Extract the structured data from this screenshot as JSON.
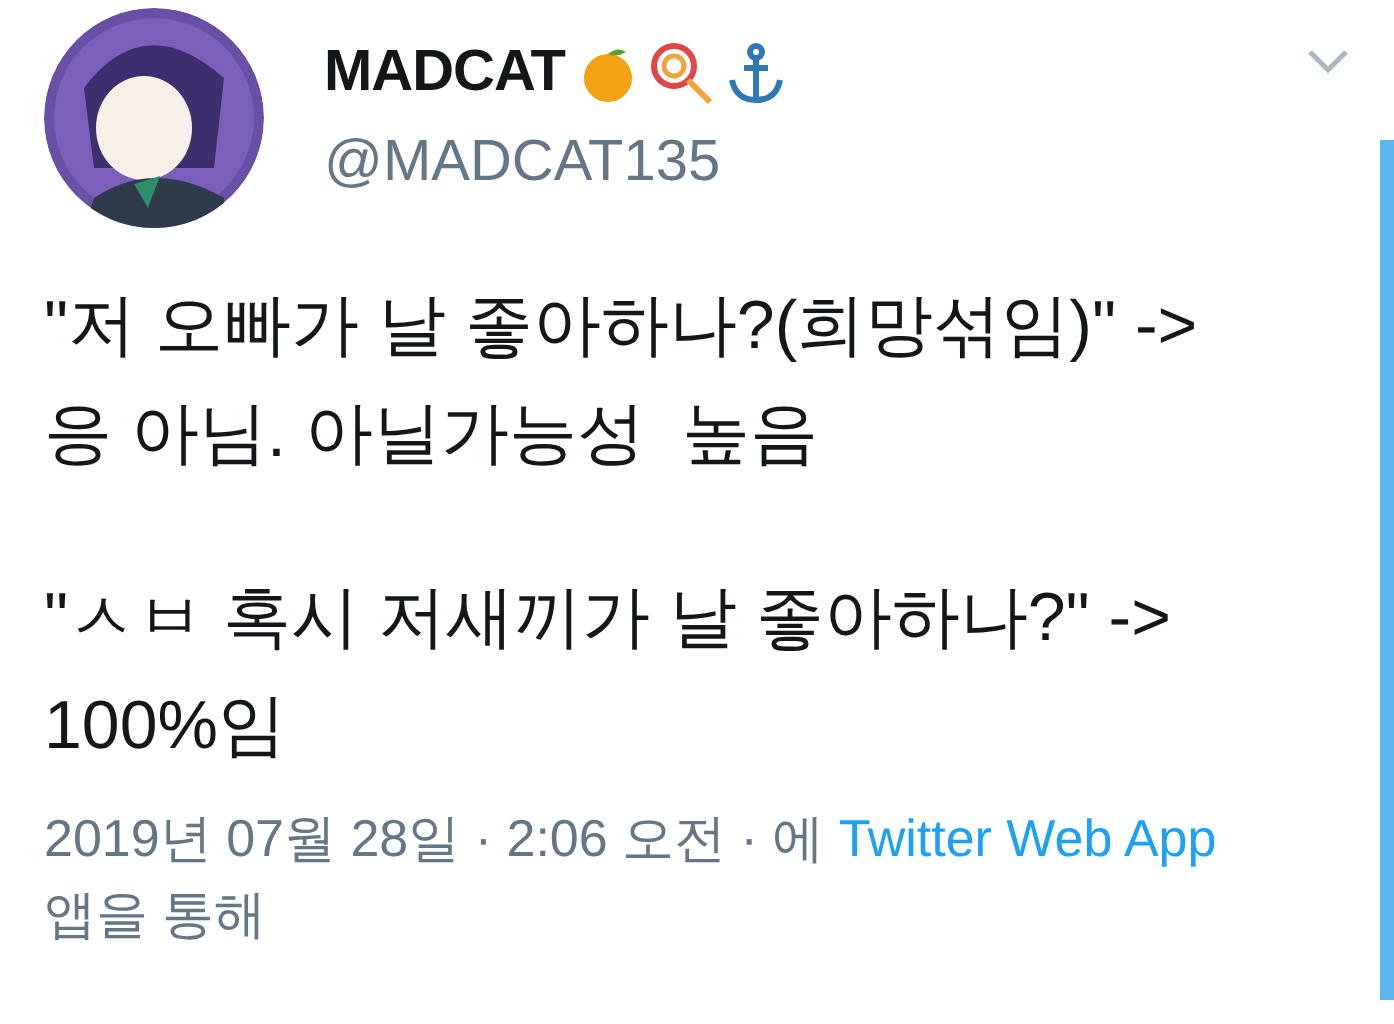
{
  "author": {
    "name": "MADCAT",
    "handle": "@MADCAT135"
  },
  "paragraphs": [
    "\"저 오빠가 날 좋아하나?(희망섞임)\" -> 응 아님. 아닐가능성  높음",
    "\"ㅅㅂ 혹시 저새끼가 날 좋아하나?\" -> 100%임"
  ],
  "meta": {
    "prefix": "2019년 07월 28일 · 2:06 오전 · 에 ",
    "link": "Twitter Web App",
    "suffix": " 앱을 통해"
  }
}
